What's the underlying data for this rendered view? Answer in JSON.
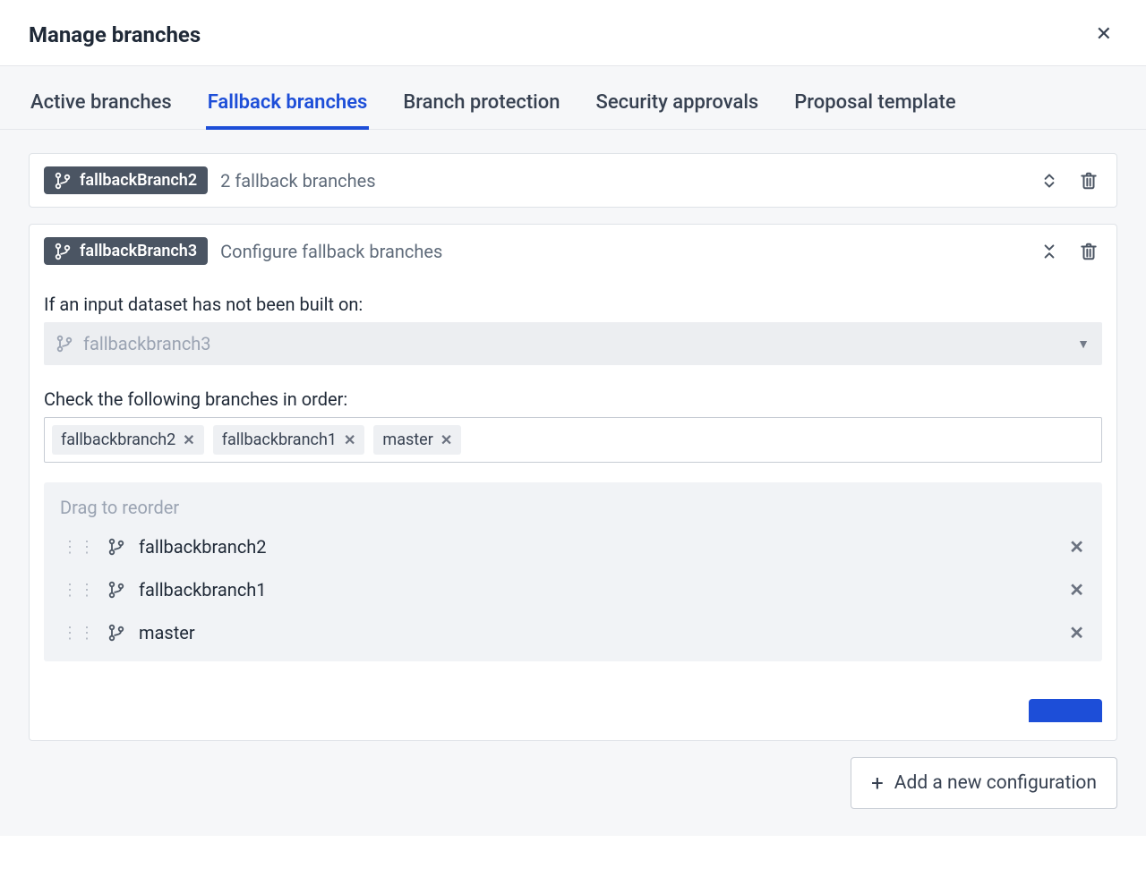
{
  "header": {
    "title": "Manage branches"
  },
  "tabs": [
    {
      "id": "active",
      "label": "Active branches",
      "active": false
    },
    {
      "id": "fallback",
      "label": "Fallback branches",
      "active": true
    },
    {
      "id": "protect",
      "label": "Branch protection",
      "active": false
    },
    {
      "id": "security",
      "label": "Security approvals",
      "active": false
    },
    {
      "id": "proposal",
      "label": "Proposal template",
      "active": false
    }
  ],
  "card_collapsed": {
    "branch": "fallbackBranch2",
    "subtitle": "2 fallback branches"
  },
  "card_expanded": {
    "branch": "fallbackBranch3",
    "subtitle": "Configure fallback branches",
    "label_if": "If an input dataset has not been built on:",
    "selected_branch": "fallbackbranch3",
    "label_check": "Check the following branches in order:",
    "tags": [
      "fallbackbranch2",
      "fallbackbranch1",
      "master"
    ],
    "reorder_title": "Drag to reorder",
    "reorder": [
      "fallbackbranch2",
      "fallbackbranch1",
      "master"
    ]
  },
  "footer": {
    "add_config": "Add a new configuration"
  }
}
